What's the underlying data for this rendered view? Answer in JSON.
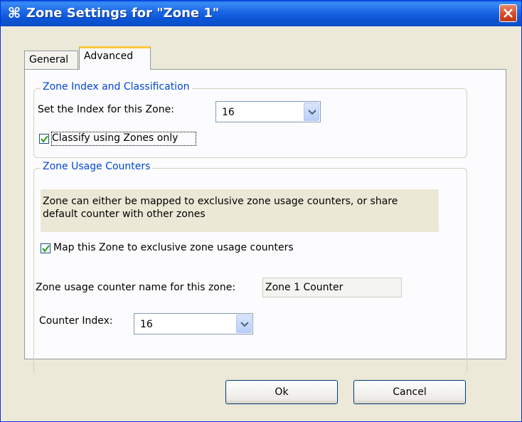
{
  "window": {
    "title": "Zone Settings for \"Zone 1\"",
    "icon": "zone-app-icon",
    "close_icon": "close-icon"
  },
  "tabs": [
    {
      "label": "General",
      "selected": false
    },
    {
      "label": "Advanced",
      "selected": true
    }
  ],
  "zone_index_group": {
    "legend": "Zone Index and Classification",
    "index_label": "Set the Index for this Zone:",
    "index_value": "16",
    "classify_label": "Classify using Zones only",
    "classify_checked": true
  },
  "usage_group": {
    "legend": "Zone Usage Counters",
    "info_text": "Zone can either be mapped to exclusive zone usage counters, or share default counter with other zones",
    "map_label": "Map this Zone to exclusive zone usage counters",
    "map_checked": true,
    "counter_name_label": "Zone usage counter name for this zone:",
    "counter_name_value": "Zone 1 Counter",
    "counter_index_label": "Counter Index:",
    "counter_index_value": "16"
  },
  "buttons": {
    "ok": "Ok",
    "cancel": "Cancel"
  },
  "colors": {
    "titlebar": "#0a5fe6",
    "legend_text": "#0046d5",
    "dialog_bg": "#ece9d8",
    "tab_highlight": "#ffc83c"
  }
}
